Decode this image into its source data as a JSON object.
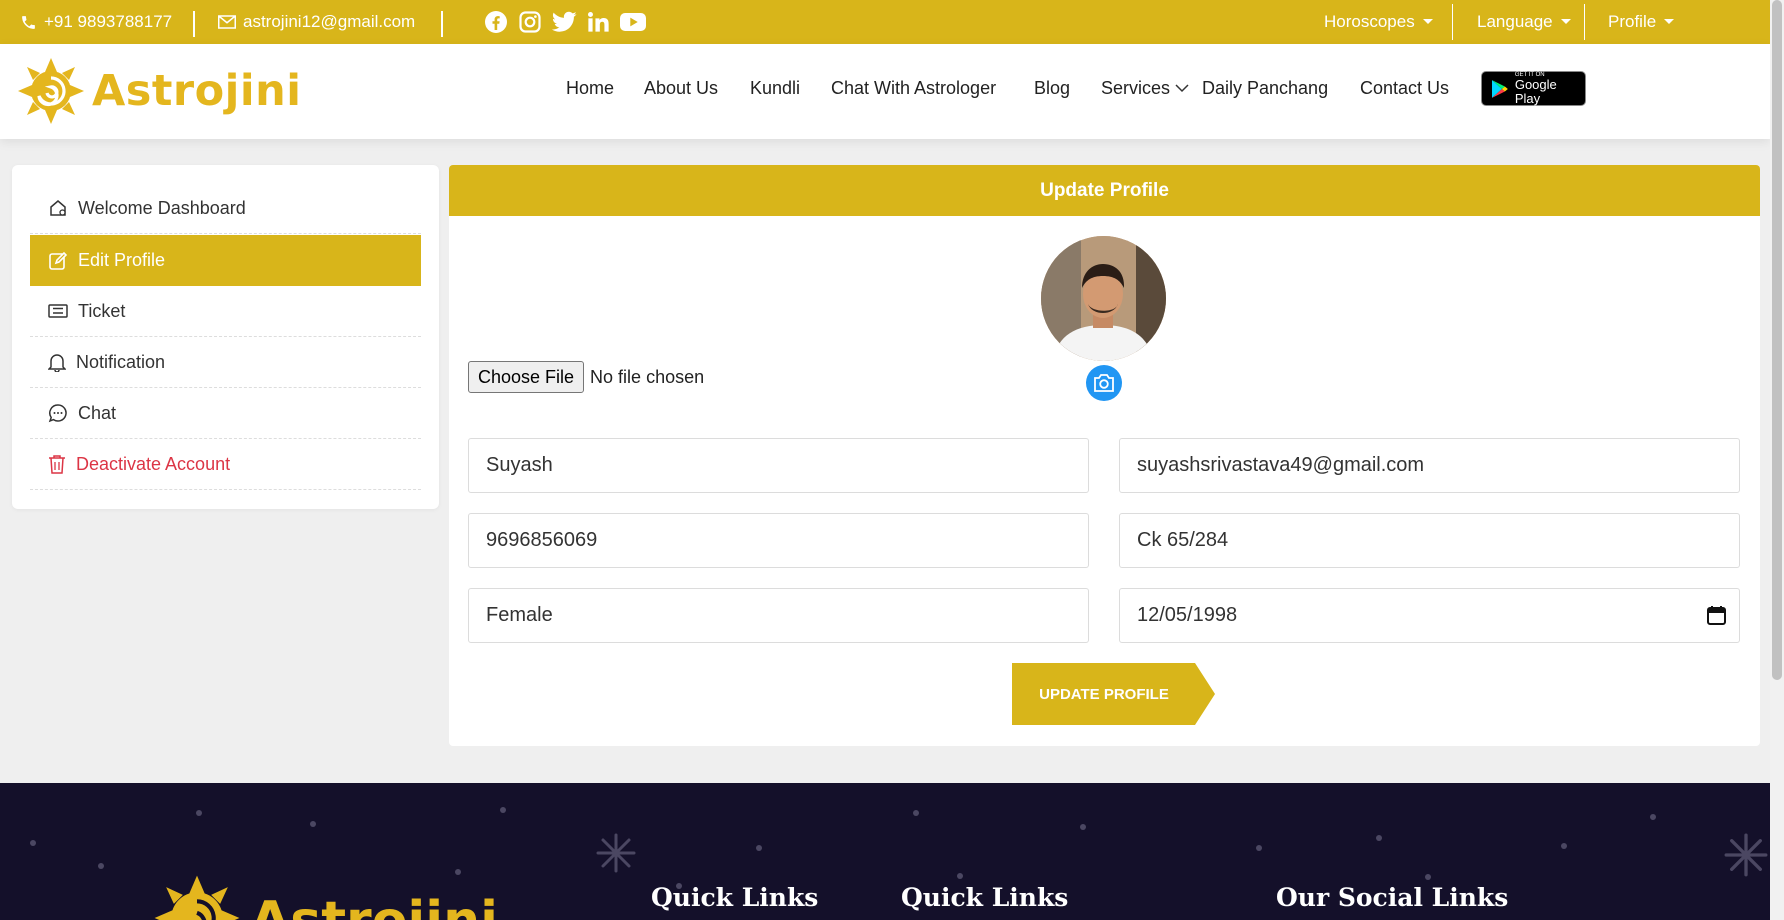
{
  "topbar": {
    "phone": "+91 9893788177",
    "email": "astrojini12@gmail.com",
    "socials": [
      "facebook-icon",
      "instagram-icon",
      "twitter-icon",
      "linkedin-icon",
      "youtube-icon"
    ],
    "menus": [
      {
        "label": "Horoscopes"
      },
      {
        "label": "Language"
      },
      {
        "label": "Profile"
      }
    ]
  },
  "header": {
    "logo_text": "Astrojini",
    "nav": [
      {
        "label": "Home"
      },
      {
        "label": "About Us"
      },
      {
        "label": "Kundli"
      },
      {
        "label": "Chat With Astrologer"
      },
      {
        "label": "Blog"
      },
      {
        "label": "Services"
      },
      {
        "label": "Daily Panchang"
      },
      {
        "label": "Contact Us"
      }
    ],
    "gplay_small": "GET IT ON",
    "gplay_big": "Google Play"
  },
  "sidebar": {
    "items": [
      {
        "label": "Welcome Dashboard",
        "icon": "home-icon"
      },
      {
        "label": "Edit Profile",
        "icon": "edit-icon",
        "active": true
      },
      {
        "label": "Ticket",
        "icon": "ticket-icon"
      },
      {
        "label": "Notification",
        "icon": "bell-icon"
      },
      {
        "label": "Chat",
        "icon": "chat-icon"
      },
      {
        "label": "Deactivate Account",
        "icon": "trash-icon"
      }
    ]
  },
  "profile": {
    "title": "Update Profile",
    "file_button": "Choose File",
    "file_status": "No file chosen",
    "name": "Suyash",
    "email": "suyashsrivastava49@gmail.com",
    "phone": "9696856069",
    "address": "Ck 65/284",
    "gender": "Female",
    "dob": "12/05/1998",
    "submit": "UPDATE PROFILE"
  },
  "footer": {
    "logo_text": "Astrojini",
    "headings": [
      "Quick Links",
      "Quick Links",
      "Our Social Links"
    ]
  },
  "colors": {
    "accent": "#d8b51a",
    "footer_bg": "#14102a",
    "danger": "#dc3545",
    "camera": "#2196f3"
  }
}
